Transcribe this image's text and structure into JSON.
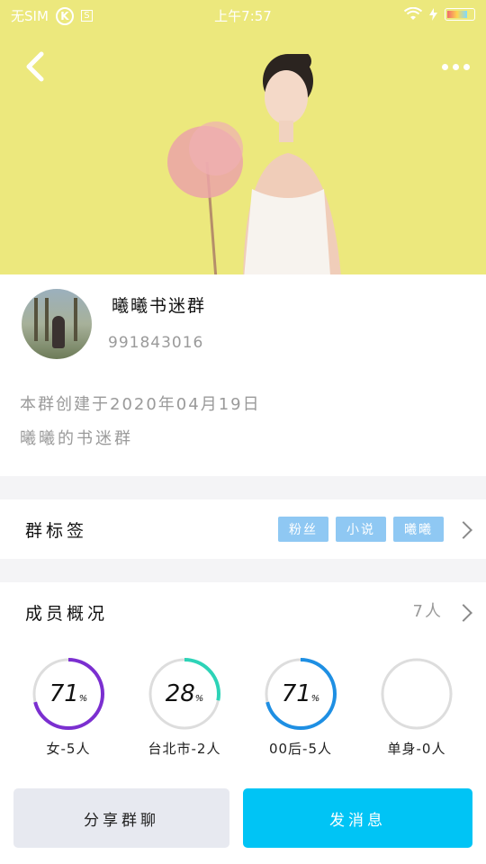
{
  "status_bar": {
    "carrier": "无SIM",
    "time": "上午7:57",
    "k_icon": "K",
    "s_icon": "S"
  },
  "header": {
    "back_icon": "chevron-left",
    "more_icon": "more-dots"
  },
  "group": {
    "name": "曦曦书迷群",
    "id": "991843016",
    "created": "本群创建于2020年04月19日",
    "description": "曦曦的书迷群"
  },
  "tags_section": {
    "title": "群标签",
    "tags": [
      "粉丝",
      "小说",
      "曦曦"
    ]
  },
  "members_section": {
    "title": "成员概况",
    "count": "7人",
    "stats": [
      {
        "percent": "71",
        "fraction": 0.71,
        "label": "女-5人",
        "color": "#7b2fd0"
      },
      {
        "percent": "28",
        "fraction": 0.28,
        "label": "台北市-2人",
        "color": "#2dd3b7"
      },
      {
        "percent": "71",
        "fraction": 0.71,
        "label": "00后-5人",
        "color": "#1e8fe3"
      },
      {
        "percent": "",
        "fraction": 0,
        "label": "单身-0人",
        "color": "#cccccc"
      }
    ]
  },
  "actions": {
    "share_label": "分享群聊",
    "send_label": "发消息"
  },
  "colors": {
    "accent": "#00c4f5",
    "tag_bg": "#8fc8f3",
    "cover_bg": "#ece87d"
  }
}
